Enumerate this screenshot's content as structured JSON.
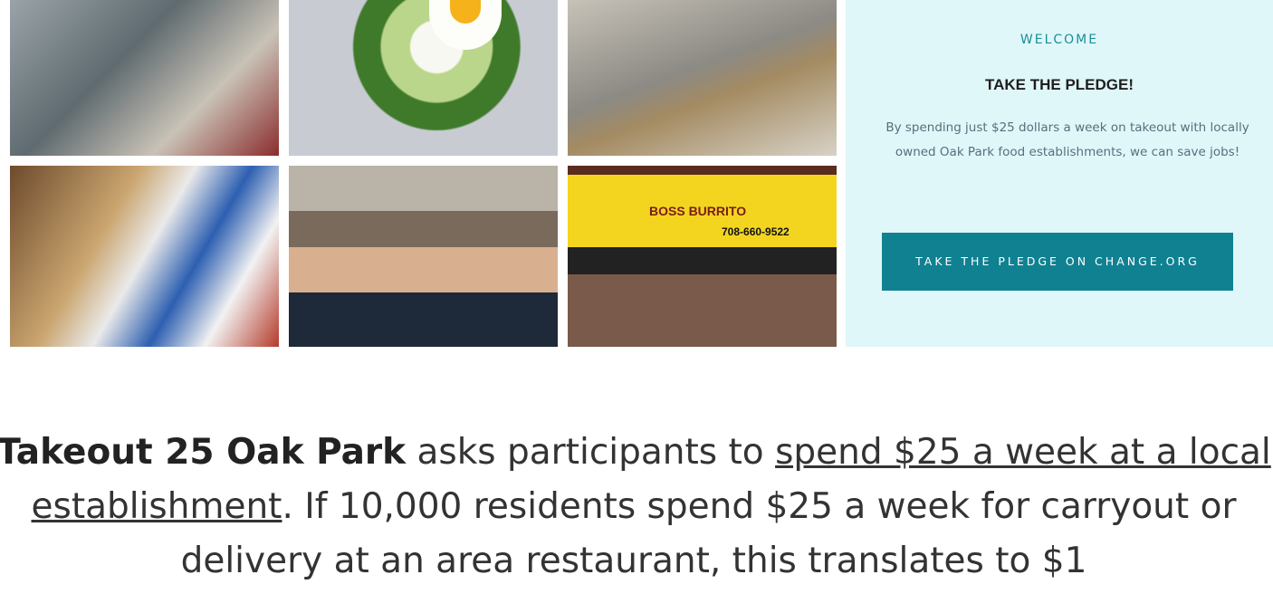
{
  "gallery": [
    {
      "name": "man with coffee tray outside"
    },
    {
      "name": "avocado toast with egg"
    },
    {
      "name": "woman carrying takeout bags"
    },
    {
      "name": "bowls and wraps on counter"
    },
    {
      "name": "two restaurant owners"
    },
    {
      "name": "burrito in front of storefront"
    }
  ],
  "burrito_sign": {
    "name": "BOSS BURRITO",
    "phone": "708-660-9522"
  },
  "pledge_panel": {
    "welcome": "WELCOME",
    "title": "TAKE THE PLEDGE!",
    "body": "By spending just $25 dollars a week on takeout with locally owned Oak Park food establishments, we can save jobs!",
    "button_label": "TAKE THE PLEDGE ON CHANGE.ORG"
  },
  "intro": {
    "brand": "Takeout 25 Oak Park",
    "text_1": " asks participants to ",
    "link_text": "spend $25 a week at a local establishment",
    "text_2": ". If 10,000 residents spend $25 a week for carryout or delivery at an area restaurant, this translates to $1"
  }
}
